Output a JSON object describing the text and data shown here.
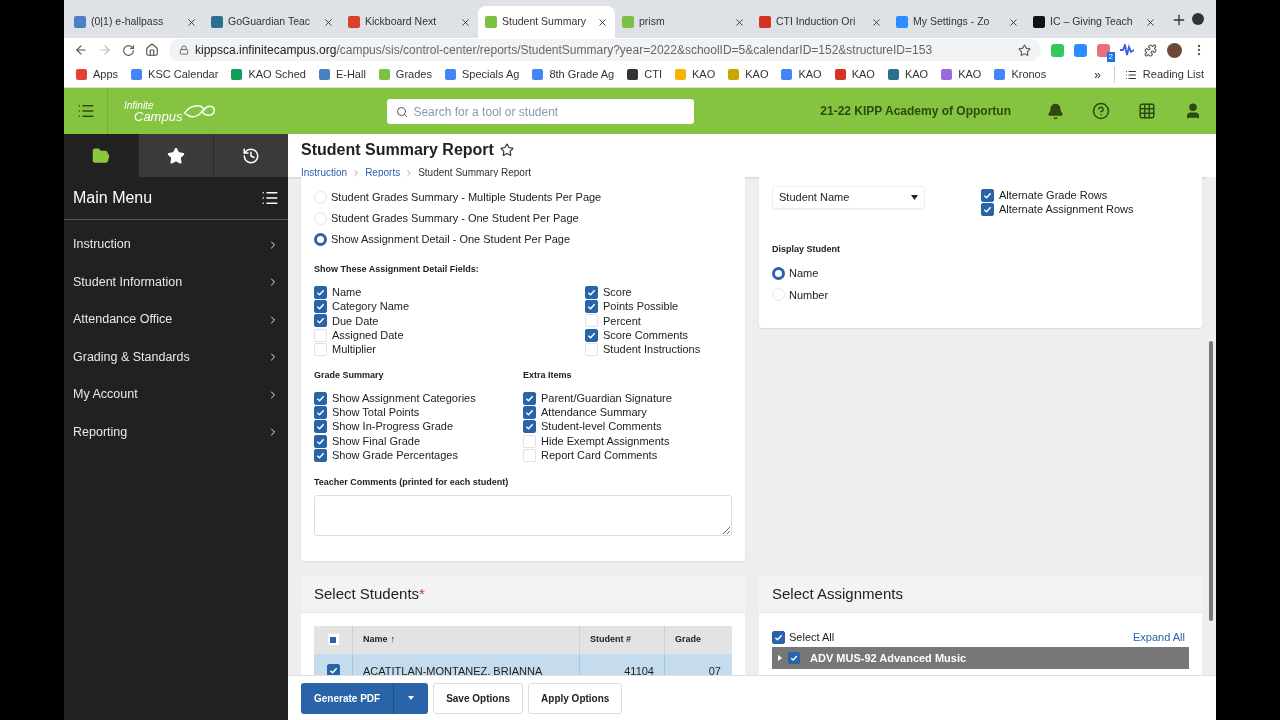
{
  "browser": {
    "tabs": [
      {
        "title": "(0|1) e-hallpass",
        "selected": false,
        "color": "#4a7fc1"
      },
      {
        "title": "GoGuardian Teac",
        "selected": false,
        "color": "#2b6f8f"
      },
      {
        "title": "Kickboard Next",
        "selected": false,
        "color": "#d9412b"
      },
      {
        "title": "Student Summary",
        "selected": true,
        "color": "#7cc142"
      },
      {
        "title": "prism",
        "selected": false,
        "color": "#7cc142"
      },
      {
        "title": "CTI Induction Ori",
        "selected": false,
        "color": "#d93025"
      },
      {
        "title": "My Settings - Zo",
        "selected": false,
        "color": "#2d8cff"
      },
      {
        "title": "IC – Giving Teach",
        "selected": false,
        "color": "#111111"
      }
    ],
    "url_host": "kippsca.infinitecampus.org",
    "url_path": "/campus/sis/control-center/reports/StudentSummary?year=2022&schoolID=5&calendarID=152&structureID=153",
    "extension_badge": "2",
    "bookmarks": [
      {
        "label": "Apps",
        "color": "#e44134"
      },
      {
        "label": "KSC Calendar",
        "color": "#4285f4"
      },
      {
        "label": "KAO Sched",
        "color": "#0f9d58"
      },
      {
        "label": "E-Hall",
        "color": "#4a7fc1"
      },
      {
        "label": "Grades",
        "color": "#7cc142"
      },
      {
        "label": "Specials Ag",
        "color": "#4285f4"
      },
      {
        "label": "8th Grade Ag",
        "color": "#4285f4"
      },
      {
        "label": "CTI",
        "color": "#333333"
      },
      {
        "label": "KAO",
        "color": "#f4b400"
      },
      {
        "label": "KAO",
        "color": "#c8a600"
      },
      {
        "label": "KAO",
        "color": "#4285f4"
      },
      {
        "label": "KAO",
        "color": "#d93025"
      },
      {
        "label": "KAO",
        "color": "#2b6f8f"
      },
      {
        "label": "KAO",
        "color": "#9c6ade"
      },
      {
        "label": "Kronos",
        "color": "#4285f4"
      }
    ],
    "more": "»",
    "reading_list": "Reading List"
  },
  "app": {
    "logo_lines": [
      "Infinite",
      "Campus"
    ],
    "search_placeholder": "Search for a tool or student",
    "school": "21-22 KIPP Academy of Opportun"
  },
  "sidebar": {
    "tabs": [
      {
        "kind": "folder",
        "selected": true
      },
      {
        "kind": "star",
        "selected": false
      },
      {
        "kind": "history",
        "selected": false
      }
    ],
    "title": "Main Menu",
    "items": [
      {
        "label": "Instruction"
      },
      {
        "label": "Student Information"
      },
      {
        "label": "Attendance Office"
      },
      {
        "label": "Grading & Standards"
      },
      {
        "label": "My Account"
      },
      {
        "label": "Reporting"
      }
    ]
  },
  "page": {
    "title": "Student Summary Report",
    "breadcrumbs": [
      {
        "label": "Instruction",
        "link": true
      },
      {
        "label": "Reports",
        "link": true
      },
      {
        "label": "Student Summary Report",
        "link": false
      }
    ]
  },
  "options": {
    "printing_options": [
      {
        "label": "Student Grades Summary - Multiple Students Per Page",
        "selected": false
      },
      {
        "label": "Student Grades Summary - One Student Per Page",
        "selected": false
      },
      {
        "label": "Show Assignment Detail - One Student Per Page",
        "selected": true
      }
    ],
    "detail_fields_heading": "Show These Assignment Detail Fields:",
    "detail_fields_left": [
      {
        "label": "Name",
        "checked": true
      },
      {
        "label": "Category Name",
        "checked": true
      },
      {
        "label": "Due Date",
        "checked": true
      },
      {
        "label": "Assigned Date",
        "checked": false
      },
      {
        "label": "Multiplier",
        "checked": false
      }
    ],
    "detail_fields_right": [
      {
        "label": "Score",
        "checked": true
      },
      {
        "label": "Points Possible",
        "checked": true
      },
      {
        "label": "Percent",
        "checked": false
      },
      {
        "label": "Score Comments",
        "checked": true
      },
      {
        "label": "Student Instructions",
        "checked": false
      }
    ],
    "grade_summary": {
      "heading": "Grade Summary",
      "items": [
        {
          "label": "Show Assignment Categories",
          "checked": true
        },
        {
          "label": "Show Total Points",
          "checked": true
        },
        {
          "label": "Show In-Progress Grade",
          "checked": true
        },
        {
          "label": "Show Final Grade",
          "checked": true
        },
        {
          "label": "Show Grade Percentages",
          "checked": true
        }
      ]
    },
    "extra_items": {
      "heading": "Extra Items",
      "items": [
        {
          "label": "Parent/Guardian Signature",
          "checked": true
        },
        {
          "label": "Attendance Summary",
          "checked": true
        },
        {
          "label": "Student-level Comments",
          "checked": true
        },
        {
          "label": "Hide Exempt Assignments",
          "checked": false
        },
        {
          "label": "Report Card Comments",
          "checked": false
        }
      ]
    },
    "teacher_comments_label": "Teacher Comments (printed for each student)",
    "student_sort_value": "Student Name",
    "shade": [
      {
        "label": "Alternate Grade Rows",
        "checked": true
      },
      {
        "label": "Alternate Assignment Rows",
        "checked": true
      }
    ],
    "display_student_heading": "Display Student",
    "display_student": [
      {
        "label": "Name",
        "selected": true
      },
      {
        "label": "Number",
        "selected": false
      }
    ]
  },
  "select_students": {
    "title": "Select Students",
    "required": "*",
    "header_checkbox": {
      "checked": true,
      "partial": true
    },
    "columns": [
      {
        "label": "Name",
        "sort": "↑"
      },
      {
        "label": "Student #"
      },
      {
        "label": "Grade"
      }
    ],
    "rows": [
      {
        "checked": true,
        "name": "ACATITLAN-MONTANEZ, BRIANNA",
        "student_number": "41104",
        "grade": "07"
      }
    ]
  },
  "select_assignments": {
    "title": "Select Assignments",
    "select_all": {
      "label": "Select All",
      "checked": true
    },
    "expand_all": "Expand All",
    "groups": [
      {
        "label": "ADV MUS-92 Advanced Music",
        "checked": true,
        "expanded": false
      }
    ]
  },
  "actions": {
    "primary": "Generate PDF",
    "buttons": [
      "Save Options",
      "Apply Options"
    ]
  }
}
